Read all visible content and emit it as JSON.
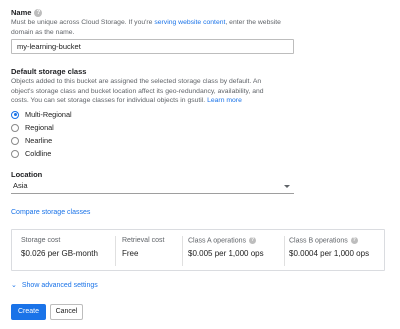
{
  "name_section": {
    "label": "Name",
    "desc_prefix": "Must be unique across Cloud Storage. If you're ",
    "desc_link": "serving website content",
    "desc_middle": ", enter the website",
    "desc_line2": "domain as the name.",
    "input_value": "my-learning-bucket"
  },
  "storage_class": {
    "label": "Default storage class",
    "desc_line1": "Objects added to this bucket are assigned the selected storage class by default. An",
    "desc_line2": "object's storage class and bucket location affect its geo-redundancy, availability, and",
    "desc_line3_prefix": "costs. You can set storage classes for individual objects in gsutil. ",
    "desc_link": "Learn more",
    "options": [
      "Multi-Regional",
      "Regional",
      "Nearline",
      "Coldline"
    ],
    "selected": "Multi-Regional"
  },
  "location": {
    "label": "Location",
    "value": "Asia"
  },
  "compare_link": "Compare storage classes",
  "costs": {
    "storage": {
      "head": "Storage cost",
      "value": "$0.026 per GB-month"
    },
    "retrieval": {
      "head": "Retrieval cost",
      "value": "Free"
    },
    "class_a": {
      "head": "Class A operations",
      "value": "$0.005 per 1,000 ops"
    },
    "class_b": {
      "head": "Class B operations",
      "value": "$0.0004 per 1,000 ops"
    }
  },
  "advanced_settings": "Show advanced settings",
  "buttons": {
    "create": "Create",
    "cancel": "Cancel"
  },
  "icons": {
    "help": "help-icon",
    "chevron": "chevron-down-icon",
    "dropdown": "caret-down-icon"
  },
  "colors": {
    "accent": "#1a73e8"
  }
}
